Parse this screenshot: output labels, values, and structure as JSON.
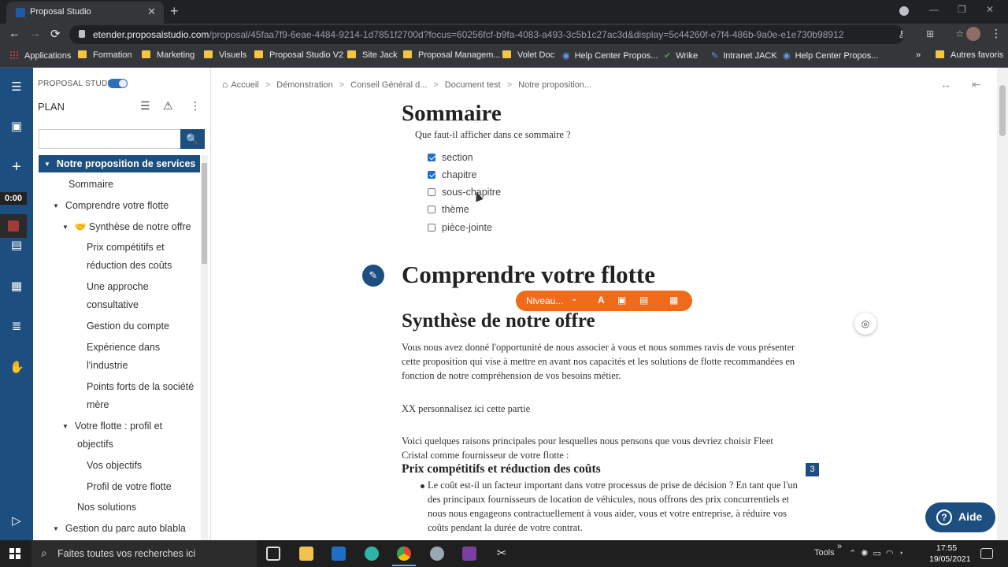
{
  "browser": {
    "tab_title": "Proposal Studio",
    "tab_close": "✕",
    "new_tab": "+",
    "url_host": "etender.proposalstudio.com",
    "url_path": "/proposal/45faa7f9-6eae-4484-9214-1d7851f2700d?focus=60256fcf-b9fa-4083-a493-3c5b1c27ac3d&display=5c44260f-e7f4-486b-9a0e-e1e730b98912",
    "back": "←",
    "forward": "→",
    "reload": "⟳",
    "omni_icons": "⚷ ⊞ ☆",
    "menu": "⋮",
    "win_minimize": "—",
    "win_maximize": "❐",
    "win_close": "✕",
    "bookmarks": [
      {
        "label": "Applications",
        "icon": "apps-grid-icon"
      },
      {
        "label": "Formation",
        "icon": "folder-icon"
      },
      {
        "label": "Marketing",
        "icon": "folder-icon"
      },
      {
        "label": "Visuels",
        "icon": "folder-icon"
      },
      {
        "label": "Proposal Studio V2",
        "icon": "folder-icon"
      },
      {
        "label": "Site Jack",
        "icon": "folder-icon"
      },
      {
        "label": "Proposal Managem...",
        "icon": "folder-icon"
      },
      {
        "label": "Volet Doc",
        "icon": "folder-icon"
      },
      {
        "label": "Help Center Propos...",
        "icon": "globe-icon"
      },
      {
        "label": "Wrike",
        "icon": "check-icon"
      },
      {
        "label": "Intranet JACK",
        "icon": "pen-icon"
      },
      {
        "label": "Help Center Propos...",
        "icon": "globe-icon"
      }
    ],
    "bookmarks_more": "»",
    "other_favorites": "Autres favoris"
  },
  "recorder": {
    "time": "0:00"
  },
  "sidebar": {
    "brand": "PROPOSAL STUDIO",
    "plan_label": "PLAN",
    "list_icon": "☰",
    "warning_icon": "⚠",
    "more_icon": "⋮",
    "search_placeholder": "",
    "search_button_icon": "🔍",
    "tree": [
      {
        "label": "Notre proposition de services",
        "level": 0,
        "caret": true,
        "active": true
      },
      {
        "label": "Sommaire",
        "level": 1
      },
      {
        "label": "Comprendre votre flotte",
        "level": 1,
        "caret": true
      },
      {
        "label": "Synthèse de notre offre",
        "level": 2,
        "caret": true,
        "icon": "handshake-icon"
      },
      {
        "label": "Prix compétitifs et",
        "level": 3
      },
      {
        "label": "réduction des coûts",
        "level": 3
      },
      {
        "label": "Une approche",
        "level": 3
      },
      {
        "label": "consultative",
        "level": 3
      },
      {
        "label": "Gestion du compte",
        "level": 3
      },
      {
        "label": "Expérience dans",
        "level": 3
      },
      {
        "label": "l'industrie",
        "level": 3
      },
      {
        "label": "Points forts de la société",
        "level": 3
      },
      {
        "label": "mère",
        "level": 3
      },
      {
        "label": "Votre flotte : profil et",
        "level": 2,
        "caret": true
      },
      {
        "label": "objectifs",
        "level": 2
      },
      {
        "label": "Vos objectifs",
        "level": 3
      },
      {
        "label": "Profil de votre flotte",
        "level": 3
      },
      {
        "label": "Nos solutions",
        "level": 2
      },
      {
        "label": "Gestion du parc auto blabla",
        "level": 1,
        "caret": true
      }
    ]
  },
  "breadcrumb": [
    "Accueil",
    "Démonstration",
    "Conseil Général d...",
    "Document test",
    "Notre proposition..."
  ],
  "breadcrumb_sep": ">",
  "header_icons": {
    "expand": "↔",
    "collapse": "⇤"
  },
  "document": {
    "summary_title": "Sommaire",
    "summary_question": "Que faut-il afficher dans ce sommaire ?",
    "summary_options": [
      {
        "label": "section",
        "checked": true
      },
      {
        "label": "chapitre",
        "checked": true
      },
      {
        "label": "sous-chapitre",
        "checked": false
      },
      {
        "label": "thème",
        "checked": false
      },
      {
        "label": "pièce-jointe",
        "checked": false
      }
    ],
    "section_title": "Comprendre votre flotte",
    "toolbar": {
      "level_label": "Niveau...",
      "chevron": "⌄",
      "icons": [
        "A",
        "▣",
        "▤",
        "▦"
      ]
    },
    "chapter_title": "Synthèse de notre offre",
    "para1": "Vous nous avez donné l'opportunité de nous associer à vous et nous sommes ravis de vous présenter cette proposition qui vise à mettre en avant nos capacités et les solutions de flotte recommandées en fonction de notre compréhension de vos besoins métier.",
    "para2": "XX personnalisez ici cette partie",
    "para3": "Voici quelques raisons principales pour lesquelles nous pensons que vous devriez choisir Fleet Cristal comme fournisseur de votre flotte :",
    "subheading": "Prix compétitifs et réduction des coûts",
    "badge_number": "3",
    "bullet1": "Le coût est-il un facteur important dans votre processus de prise de décision ? En tant que l'un des principaux fournisseurs de location de véhicules, nous offrons des prix concurrentiels et nous nous engageons contractuellement à vous aider, vous et votre entreprise, à réduire vos coûts pendant la durée de votre contrat."
  },
  "help_button": {
    "label": "Aide",
    "icon": "?"
  },
  "taskbar": {
    "search_text": "Faites toutes vos recherches ici",
    "tools_label": "Tools",
    "tray_chevron": "»",
    "time": "17:55",
    "date": "19/05/2021"
  }
}
